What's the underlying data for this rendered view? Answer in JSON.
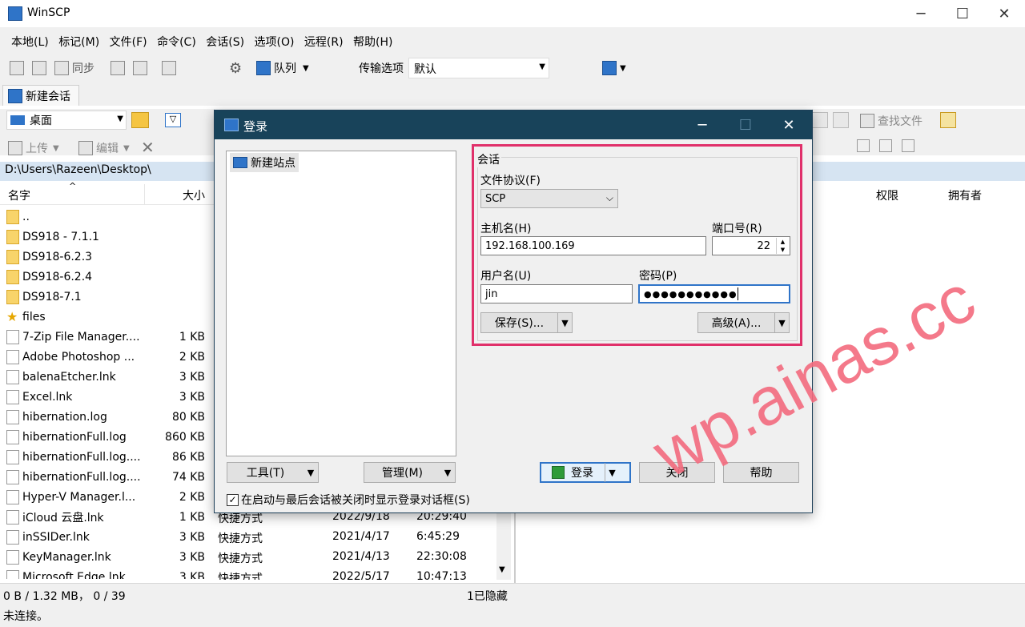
{
  "app": {
    "title": "WinSCP"
  },
  "menu": [
    "本地(L)",
    "标记(M)",
    "文件(F)",
    "命令(C)",
    "会话(S)",
    "选项(O)",
    "远程(R)",
    "帮助(H)"
  ],
  "toolbar": {
    "sync": "同步",
    "queue": "队列",
    "transfer_options_label": "传输选项",
    "transfer_options_value": "默认"
  },
  "session_tab": "新建会话",
  "local": {
    "drive": "桌面",
    "upload": "上传",
    "edit": "编辑",
    "path": "D:\\Users\\Razeen\\Desktop\\",
    "col_name": "名字",
    "col_size": "大小",
    "files": [
      {
        "name": "..",
        "size": "",
        "icon": "parent-folder-icon"
      },
      {
        "name": "DS918 - 7.1.1",
        "size": "",
        "icon": "folder-icon"
      },
      {
        "name": "DS918-6.2.3",
        "size": "",
        "icon": "folder-icon"
      },
      {
        "name": "DS918-6.2.4",
        "size": "",
        "icon": "folder-icon"
      },
      {
        "name": "DS918-7.1",
        "size": "",
        "icon": "folder-icon"
      },
      {
        "name": "files",
        "size": "",
        "icon": "star-icon"
      },
      {
        "name": "7-Zip File Manager....",
        "size": "1 KB",
        "icon": "shortcut-icon"
      },
      {
        "name": "Adobe Photoshop ...",
        "size": "2 KB",
        "icon": "photoshop-icon"
      },
      {
        "name": "balenaEtcher.lnk",
        "size": "3 KB",
        "icon": "shortcut-icon"
      },
      {
        "name": "Excel.lnk",
        "size": "3 KB",
        "icon": "excel-icon"
      },
      {
        "name": "hibernation.log",
        "size": "80 KB",
        "icon": "file-icon"
      },
      {
        "name": "hibernationFull.log",
        "size": "860 KB",
        "icon": "file-icon"
      },
      {
        "name": "hibernationFull.log....",
        "size": "86 KB",
        "icon": "file-icon"
      },
      {
        "name": "hibernationFull.log....",
        "size": "74 KB",
        "icon": "file-icon"
      },
      {
        "name": "Hyper-V Manager.l...",
        "size": "2 KB",
        "icon": "shortcut-icon"
      },
      {
        "name": "iCloud 云盘.lnk",
        "size": "1 KB",
        "icon": "cloud-icon"
      },
      {
        "name": "inSSIDer.lnk",
        "size": "3 KB",
        "icon": "shortcut-icon"
      },
      {
        "name": "KeyManager.lnk",
        "size": "3 KB",
        "icon": "shortcut-icon"
      },
      {
        "name": "Microsoft Edge.lnk",
        "size": "3 KB",
        "icon": "edge-icon"
      }
    ],
    "extra_rows": [
      {
        "type": "快捷方式",
        "date": "2022/9/18",
        "time": "20:29:40"
      },
      {
        "type": "快捷方式",
        "date": "2021/4/17",
        "time": "6:45:29"
      },
      {
        "type": "快捷方式",
        "date": "2021/4/13",
        "time": "22:30:08"
      },
      {
        "type": "快捷方式",
        "date": "2022/5/17",
        "time": "10:47:13"
      }
    ]
  },
  "remote": {
    "find_files": "查找文件",
    "col_perm": "权限",
    "col_owner": "拥有者"
  },
  "status": {
    "selection": "0 B / 1.32 MB，  0 / 39",
    "hidden": "1已隐藏",
    "connection": "未连接。"
  },
  "login": {
    "title": "登录",
    "new_site": "新建站点",
    "group": "会话",
    "protocol_label": "文件协议(F)",
    "protocol_value": "SCP",
    "host_label": "主机名(H)",
    "host_value": "192.168.100.169",
    "port_label": "端口号(R)",
    "port_value": "22",
    "user_label": "用户名(U)",
    "user_value": "jin",
    "pass_label": "密码(P)",
    "pass_value": "●●●●●●●●●●●",
    "save": "保存(S)...",
    "advanced": "高级(A)...",
    "tools": "工具(T)",
    "manage": "管理(M)",
    "login_btn": "登录",
    "close_btn": "关闭",
    "help_btn": "帮助",
    "checkbox_label": "在启动与最后会话被关闭时显示登录对话框(S)",
    "checkbox_checked": true
  },
  "watermark": "wp.ainas.cc"
}
